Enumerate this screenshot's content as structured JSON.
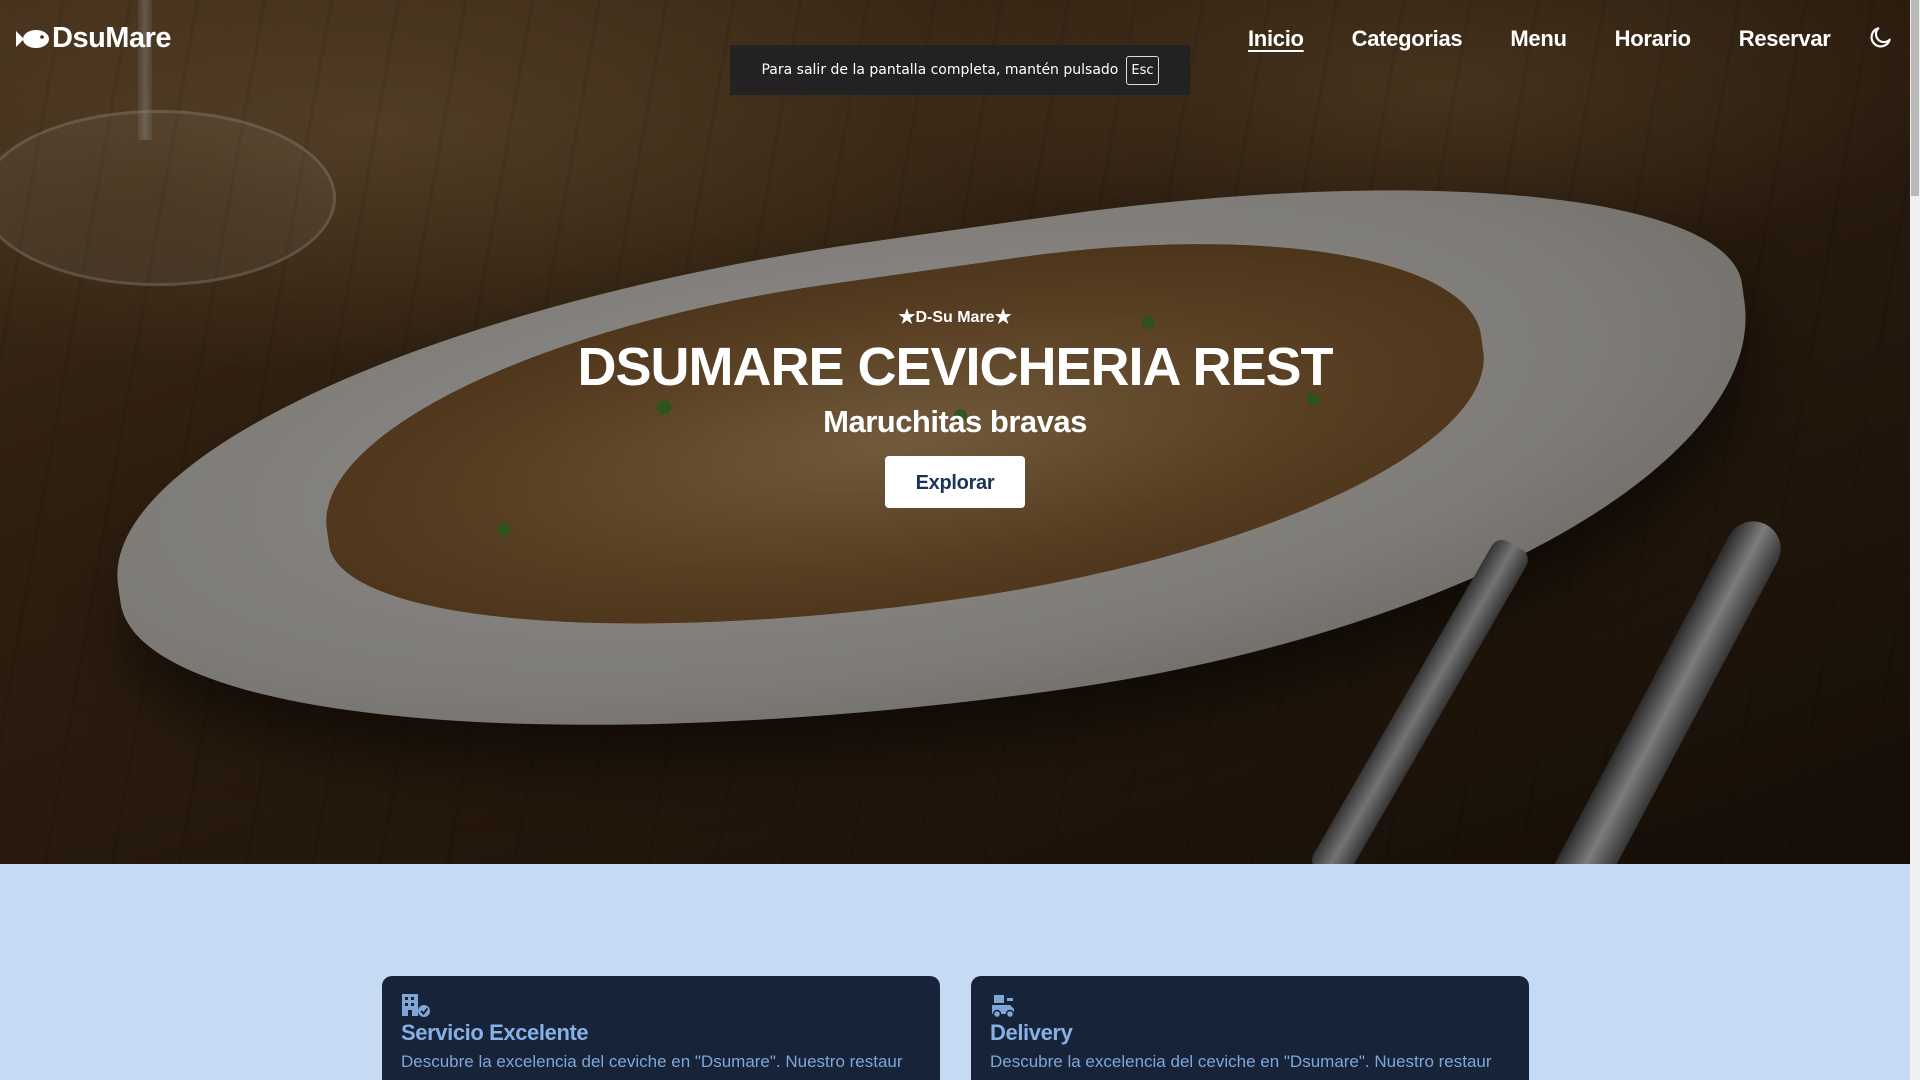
{
  "nav": {
    "logo": "DsuMare",
    "links": [
      "Inicio",
      "Categorias",
      "Menu",
      "Horario",
      "Reservar"
    ],
    "active": "Inicio",
    "theme_toggle_icon": "moon-icon"
  },
  "fullscreen_notice": {
    "text": "Para salir de la pantalla completa, mantén pulsado",
    "key": "Esc"
  },
  "hero": {
    "tagline": "D-Su Mare",
    "title": "DSUMARE CEVICHERIA REST",
    "subtitle": "Maruchitas bravas",
    "button": "Explorar"
  },
  "cards": [
    {
      "icon": "building-check-icon",
      "title": "Servicio Excelente",
      "text": "Descubre la excelencia del ceviche en \"Dsumare\". Nuestro restaur"
    },
    {
      "icon": "delivery-icon",
      "title": "Delivery",
      "text": "Descubre la excelencia del ceviche en \"Dsumare\". Nuestro restaur"
    }
  ],
  "colors": {
    "section_bg": "#c6dbf3",
    "card_bg": "#172338",
    "card_text": "#7ea7d8",
    "button_text": "#1c3359"
  }
}
